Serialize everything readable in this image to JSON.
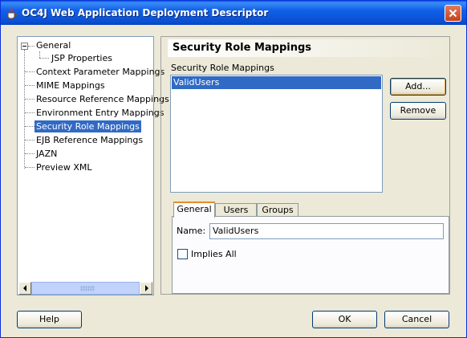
{
  "window": {
    "title": "OC4J Web Application Deployment Descriptor"
  },
  "tree": {
    "items": [
      {
        "label": "General"
      },
      {
        "label": "JSP Properties"
      },
      {
        "label": "Context Parameter Mappings"
      },
      {
        "label": "MIME Mappings"
      },
      {
        "label": "Resource Reference Mappings"
      },
      {
        "label": "Environment Entry Mappings"
      },
      {
        "label": "Security Role Mappings",
        "selected": true
      },
      {
        "label": "EJB Reference Mappings"
      },
      {
        "label": "JAZN"
      },
      {
        "label": "Preview XML"
      }
    ]
  },
  "panel": {
    "title": "Security Role Mappings",
    "list_label": "Security Role Mappings",
    "list_items": [
      "ValidUsers"
    ],
    "add_label": "Add...",
    "remove_label": "Remove",
    "tabs": [
      "General",
      "Users",
      "Groups"
    ],
    "name_label": "Name:",
    "name_value": "ValidUsers",
    "implies_all_label": "Implies All"
  },
  "footer": {
    "help_label": "Help",
    "ok_label": "OK",
    "cancel_label": "Cancel"
  },
  "colors": {
    "selection": "#316ac5",
    "titlebar": "#0a4fd1",
    "face": "#ece9d8",
    "tab_accent": "#e68b2c"
  },
  "icons": [
    "coffee-cup-icon",
    "close-icon",
    "collapse-icon",
    "scroll-left-icon",
    "scroll-right-icon"
  ]
}
